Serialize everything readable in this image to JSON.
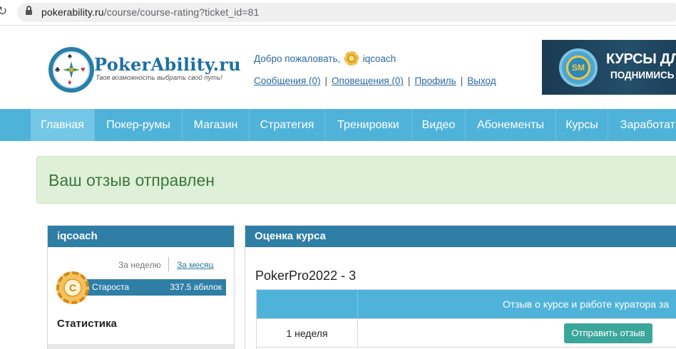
{
  "browser": {
    "url_host": "pokerability.ru",
    "url_path": "/course/course-rating?ticket_id=81"
  },
  "header": {
    "brand_name": "PokerAbility.ru",
    "tagline": "Твоя возможность выбрать свой путь!",
    "welcome_text": "Добро пожаловать,",
    "username": "iqcoach",
    "links": [
      {
        "label": "Сообщения (0)"
      },
      {
        "label": "Оповещения (0)"
      },
      {
        "label": "Профиль"
      },
      {
        "label": "Выход"
      }
    ],
    "link_separator": "|",
    "banner": {
      "logo_text": "SM",
      "line1": "КУРСЫ ДЛЯ Н",
      "line2": "ПОДНИМИСЬ С МИ"
    }
  },
  "nav": {
    "items": [
      {
        "label": "Главная",
        "active": true
      },
      {
        "label": "Покер-румы"
      },
      {
        "label": "Магазин"
      },
      {
        "label": "Стратегия"
      },
      {
        "label": "Тренировки"
      },
      {
        "label": "Видео"
      },
      {
        "label": "Абонементы"
      },
      {
        "label": "Курсы"
      },
      {
        "label": "Заработать"
      }
    ]
  },
  "alert": {
    "message": "Ваш отзыв отправлен"
  },
  "user_panel": {
    "title": "iqcoach",
    "period_week": "За неделю",
    "period_month": "За месяц",
    "rank_letter": "C",
    "rank_name": "Староста",
    "rank_points": "337.5 абилок",
    "stats_title": "Статистика"
  },
  "course_panel": {
    "title": "Оценка курса",
    "course_name": "PokerPro2022 - 3",
    "table_header": "Отзыв о курсе и работе куратора за",
    "rows": [
      {
        "week": "1 неделя",
        "button": "Отправить отзыв"
      }
    ]
  },
  "colors": {
    "nav_bg": "#4fb3d9",
    "panel_head": "#2f7ea6",
    "alert_bg": "#dff0d8",
    "alert_text": "#3c763d",
    "button": "#3aa79a"
  }
}
